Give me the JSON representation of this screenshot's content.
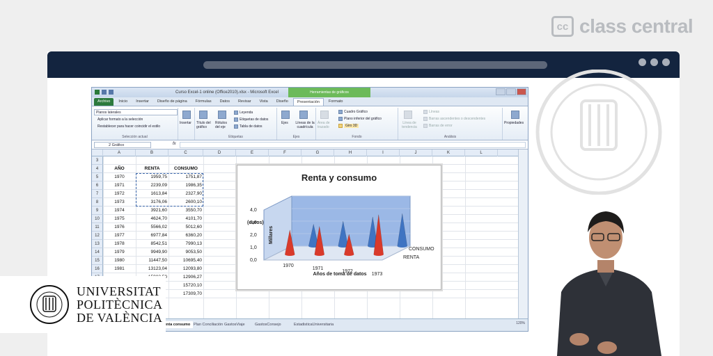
{
  "brand": {
    "logo_letters": "cc",
    "name": "class central"
  },
  "excel": {
    "title": "Curso Excel-1 online (Office2010).xlsx - Microsoft Excel",
    "context_tab": "Herramientas de gráficos",
    "tabs": [
      "Archivo",
      "Inicio",
      "Insertar",
      "Diseño de página",
      "Fórmulas",
      "Datos",
      "Revisar",
      "Vista",
      "Diseño",
      "Presentación",
      "Formato"
    ],
    "active_tab": "Presentación",
    "ribbon": {
      "selection_dropdown": "Planos laterales",
      "apply_format": "Aplicar formato a la selección",
      "reset_style": "Restablecer para hacer coincidir el estilo",
      "group_selection": "Selección actual",
      "insert": "Insertar",
      "chart_title": "Título del gráfico",
      "axis_titles": "Rótulos del eje",
      "legend": "Leyenda",
      "data_labels": "Etiquetas de datos",
      "data_table": "Tabla de datos",
      "group_labels": "Etiquetas",
      "axes": "Ejes",
      "gridlines": "Líneas de la cuadrícula",
      "group_axes": "Ejes",
      "plot_area": "Área de trazado",
      "chart_wall": "Cuadro Gráfico",
      "chart_floor": "Plano inferior del gráfico",
      "rotation": "Giro 3D",
      "group_background": "Fondo",
      "trendline": "Línea de tendencia",
      "lines": "Líneas",
      "updown_bars": "Barras ascendentes o descendentes",
      "error_bars": "Barras de error",
      "group_analysis": "Análisis",
      "properties": "Propiedades"
    },
    "name_box": "2 Gráfico",
    "fx": "fx",
    "columns": [
      "A",
      "B",
      "C",
      "D",
      "E",
      "F",
      "G",
      "H",
      "I",
      "J",
      "K",
      "L"
    ],
    "header_row": {
      "year": "AÑO",
      "renta": "RENTA",
      "consumo": "CONSUMO"
    },
    "rows": [
      {
        "n": "3",
        "year": "",
        "renta": "",
        "consumo": ""
      },
      {
        "n": "4",
        "year": "AÑO",
        "renta": "RENTA",
        "consumo": "CONSUMO"
      },
      {
        "n": "5",
        "year": "1970",
        "renta": "1959,75",
        "consumo": "1751,87"
      },
      {
        "n": "6",
        "year": "1971",
        "renta": "2239,09",
        "consumo": "1986,35"
      },
      {
        "n": "7",
        "year": "1972",
        "renta": "1613,84",
        "consumo": "2327,90"
      },
      {
        "n": "8",
        "year": "1973",
        "renta": "3176,06",
        "consumo": "2600,10"
      },
      {
        "n": "9",
        "year": "1974",
        "renta": "3921,60",
        "consumo": "3550,70"
      },
      {
        "n": "10",
        "year": "1975",
        "renta": "4624,70",
        "consumo": "4101,70"
      },
      {
        "n": "11",
        "year": "1976",
        "renta": "5566,02",
        "consumo": "5012,60"
      },
      {
        "n": "12",
        "year": "1977",
        "renta": "6977,84",
        "consumo": "6360,20"
      },
      {
        "n": "13",
        "year": "1978",
        "renta": "8542,51",
        "consumo": "7990,13"
      },
      {
        "n": "14",
        "year": "1979",
        "renta": "9949,90",
        "consumo": "9053,50"
      },
      {
        "n": "15",
        "year": "1980",
        "renta": "11447,50",
        "consumo": "10695,40"
      },
      {
        "n": "16",
        "year": "1981",
        "renta": "13123,04",
        "consumo": "12093,80"
      },
      {
        "n": "17",
        "year": "",
        "renta": "15983,50",
        "consumo": "12906,27"
      },
      {
        "n": "18",
        "year": "",
        "renta": "",
        "consumo": "15720,10"
      },
      {
        "n": "19",
        "year": "",
        "renta": "",
        "consumo": "17309,70"
      }
    ],
    "sheet_tabs": [
      "Renta consumo",
      "Plan Conciliación",
      "GastosViaje",
      "GastosConsejo",
      "EstadisticaUniversitaria"
    ],
    "active_sheet": "Renta consumo",
    "zoom": "120%"
  },
  "chart_data": {
    "type": "bar",
    "title": "Renta y consumo",
    "ylabel": "Millares",
    "yunit_label": "(euros)",
    "xlabel": "Años de toma de datos",
    "categories": [
      "1970",
      "1971",
      "1972",
      "1973"
    ],
    "y_ticks": [
      "4,0",
      "3,0",
      "2,0",
      "1,0",
      "0,0"
    ],
    "ylim": [
      0,
      4
    ],
    "series": [
      {
        "name": "CONSUMO",
        "values": [
          1.75,
          1.99,
          2.33,
          2.6
        ]
      },
      {
        "name": "RENTA",
        "values": [
          1.96,
          2.24,
          1.61,
          3.18
        ]
      }
    ],
    "colors": {
      "CONSUMO": "#3f74c2",
      "RENTA": "#d93a2b"
    }
  },
  "university": {
    "line1": "UNIVERSITAT",
    "line2": "POLITÈCNICA",
    "line3": "DE VALÈNCIA",
    "seal_text": "UNIVERSITAT POLITÈCNICA DE VALÈNCIA"
  }
}
